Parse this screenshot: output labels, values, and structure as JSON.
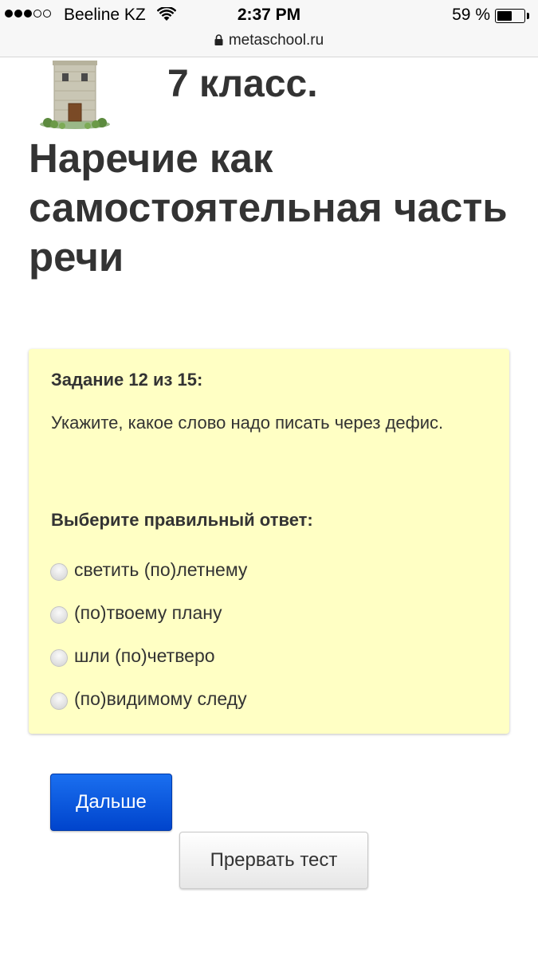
{
  "status_bar": {
    "carrier": "Beeline KZ",
    "time": "2:37 PM",
    "battery_percent": "59 %",
    "battery_level": 0.59,
    "signal_bars_filled": 3,
    "signal_bars_total": 5
  },
  "url_bar": {
    "url": "metaschool.ru",
    "lock_icon": "lock-icon"
  },
  "header": {
    "logo_icon": "tower-icon",
    "grade": "7 класс.",
    "title": "Наречие как самостоятельная часть речи"
  },
  "task": {
    "counter": "Задание 12 из 15:",
    "question": "Укажите, какое слово надо писать через дефис.",
    "answer_prompt": "Выберите правильный ответ:",
    "options": [
      {
        "label": "светить (по)летнему"
      },
      {
        "label": "(по)твоему плану"
      },
      {
        "label": "шли (по)четверо"
      },
      {
        "label": "(по)видимому следу"
      }
    ]
  },
  "buttons": {
    "next_label": "Дальше",
    "stop_label": "Прервать тест"
  },
  "colors": {
    "task_background": "#ffffc4",
    "primary_button": "#0055dd",
    "text": "#333333"
  }
}
